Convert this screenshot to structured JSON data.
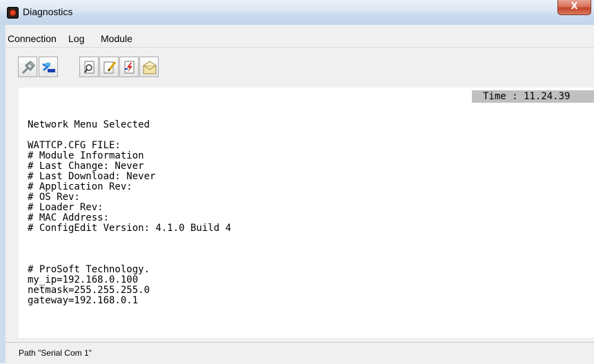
{
  "window": {
    "title": "Diagnostics",
    "close_glyph": "X",
    "app_icon": "diagnostics-app-icon"
  },
  "menu": [
    "Connection",
    "Log",
    "Module"
  ],
  "toolbar": [
    {
      "icon": "disconnect-icon"
    },
    {
      "icon": "connect-icon"
    },
    {
      "icon": "find-icon"
    },
    {
      "icon": "edit-icon"
    },
    {
      "icon": "flash-file-icon"
    },
    {
      "icon": "mail-icon"
    }
  ],
  "time_display": "Time : 11.24.39",
  "terminal": {
    "line_1": "Network Menu Selected",
    "block_1": [
      "WATTCP.CFG FILE:",
      "# Module Information",
      "# Last Change: Never",
      "# Last Download: Never",
      "# Application Rev:",
      "# OS Rev:",
      "# Loader Rev:",
      "# MAC Address:",
      "# ConfigEdit Version: 4.1.0 Build 4"
    ],
    "block_2": [
      "# ProSoft Technology.",
      "my_ip=192.168.0.100",
      "netmask=255.255.255.0",
      "gateway=192.168.0.1"
    ]
  },
  "status": "Path \"Serial Com 1\""
}
